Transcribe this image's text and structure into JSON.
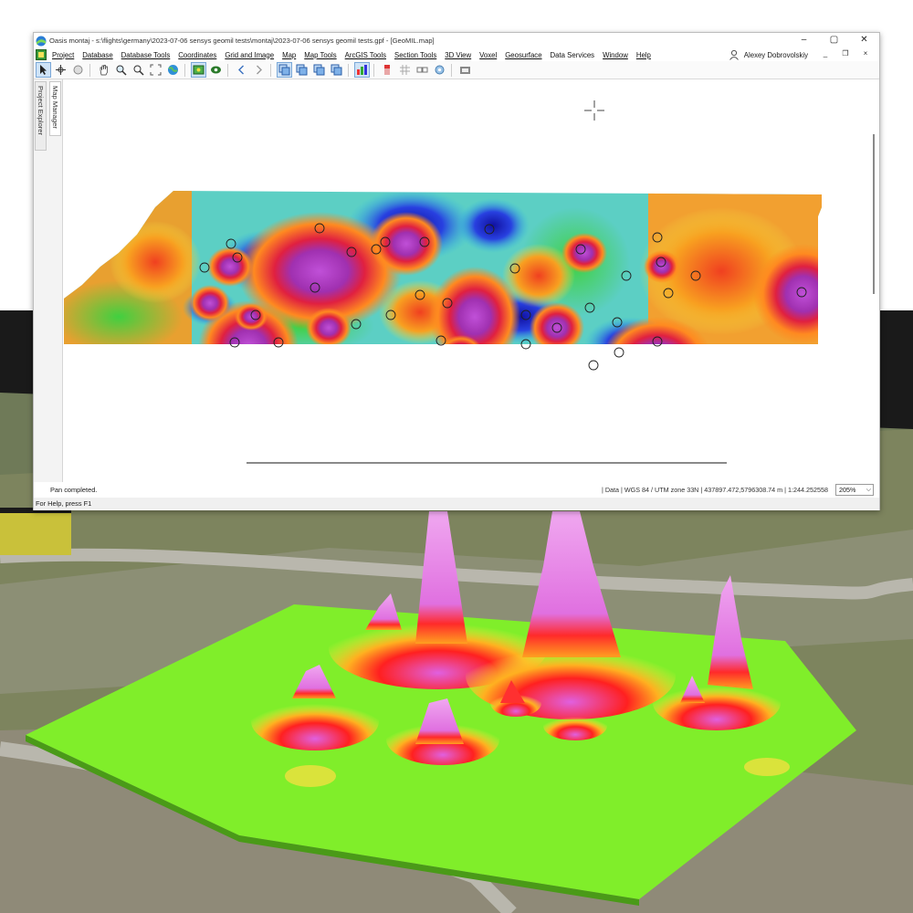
{
  "window": {
    "title": "Oasis montaj - s:\\flights\\germany\\2023-07-06 sensys geomil tests\\montaj\\2023-07-06 sensys geomil tests.gpf - [GeoMIL.map]",
    "minimize": "–",
    "restore": "▢",
    "close": "✕"
  },
  "menu": {
    "items": [
      "Project",
      "Database",
      "Database Tools",
      "Coordinates",
      "Grid and Image",
      "Map",
      "Map Tools",
      "ArcGIS Tools",
      "Section Tools",
      "3D View",
      "Voxel",
      "Geosurface",
      "Data Services",
      "Window",
      "Help"
    ],
    "user": "Alexey Dobrovolskiy",
    "mdi_minimize": "_",
    "mdi_restore": "❐",
    "mdi_close": "×"
  },
  "side_tabs": [
    "Project Explorer",
    "Map Manager"
  ],
  "toolbar": {
    "icons": [
      "pointer-icon",
      "select-icon",
      "circle-icon",
      "pan-hand-icon",
      "zoom-window-icon",
      "zoom-in-icon",
      "zoom-extents-icon",
      "globe-icon",
      "layer-icon",
      "layer-alt-icon",
      "back-icon",
      "forward-icon",
      "view-1-icon",
      "view-2-icon",
      "view-3-icon",
      "view-4-icon",
      "color-bar-icon",
      "stack-icon",
      "grid-icon",
      "connect-icon",
      "settings-icon",
      "camera-icon"
    ]
  },
  "statusbar": {
    "left": "Pan completed.",
    "right": "| Data  | WGS 84 / UTM zone 33N  | 437897.472,5796308.74 m  | 1:244.252558",
    "zoom": "205%"
  },
  "helpbar": "For Help, press F1",
  "colors": {
    "grid_low": "#1c1cc8",
    "grid_mid": "#22d4d4",
    "grid_green": "#49d84a",
    "grid_high": "#e02020",
    "grid_peak": "#b040c0",
    "surface": "#7bef2a"
  }
}
